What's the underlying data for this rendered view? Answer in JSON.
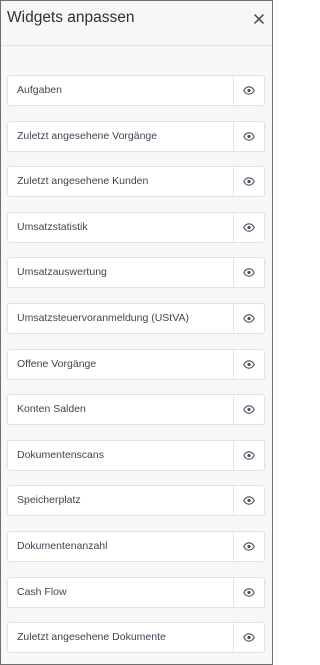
{
  "header": {
    "title": "Widgets anpassen",
    "close_icon": "close-icon"
  },
  "widgets": [
    {
      "label": "Aufgaben",
      "icon": "eye-icon"
    },
    {
      "label": "Zuletzt angesehene Vorgänge",
      "icon": "eye-icon"
    },
    {
      "label": "Zuletzt angesehene Kunden",
      "icon": "eye-icon"
    },
    {
      "label": "Umsatzstatistik",
      "icon": "eye-icon"
    },
    {
      "label": "Umsatzauswertung",
      "icon": "eye-icon"
    },
    {
      "label": "Umsatzsteuervoranmeldung (UStVA)",
      "icon": "eye-icon"
    },
    {
      "label": "Offene Vorgänge",
      "icon": "eye-icon"
    },
    {
      "label": "Konten Salden",
      "icon": "eye-icon"
    },
    {
      "label": "Dokumentenscans",
      "icon": "eye-icon"
    },
    {
      "label": "Speicherplatz",
      "icon": "eye-icon"
    },
    {
      "label": "Dokumentenanzahl",
      "icon": "eye-icon"
    },
    {
      "label": "Cash Flow",
      "icon": "eye-icon"
    },
    {
      "label": "Zuletzt angesehene Dokumente",
      "icon": "eye-icon"
    }
  ],
  "colors": {
    "panel_background": "#f7f7f8",
    "row_background": "#ffffff",
    "row_border": "#dfe2e6",
    "text": "#3d4652",
    "icon": "#4a5260"
  }
}
